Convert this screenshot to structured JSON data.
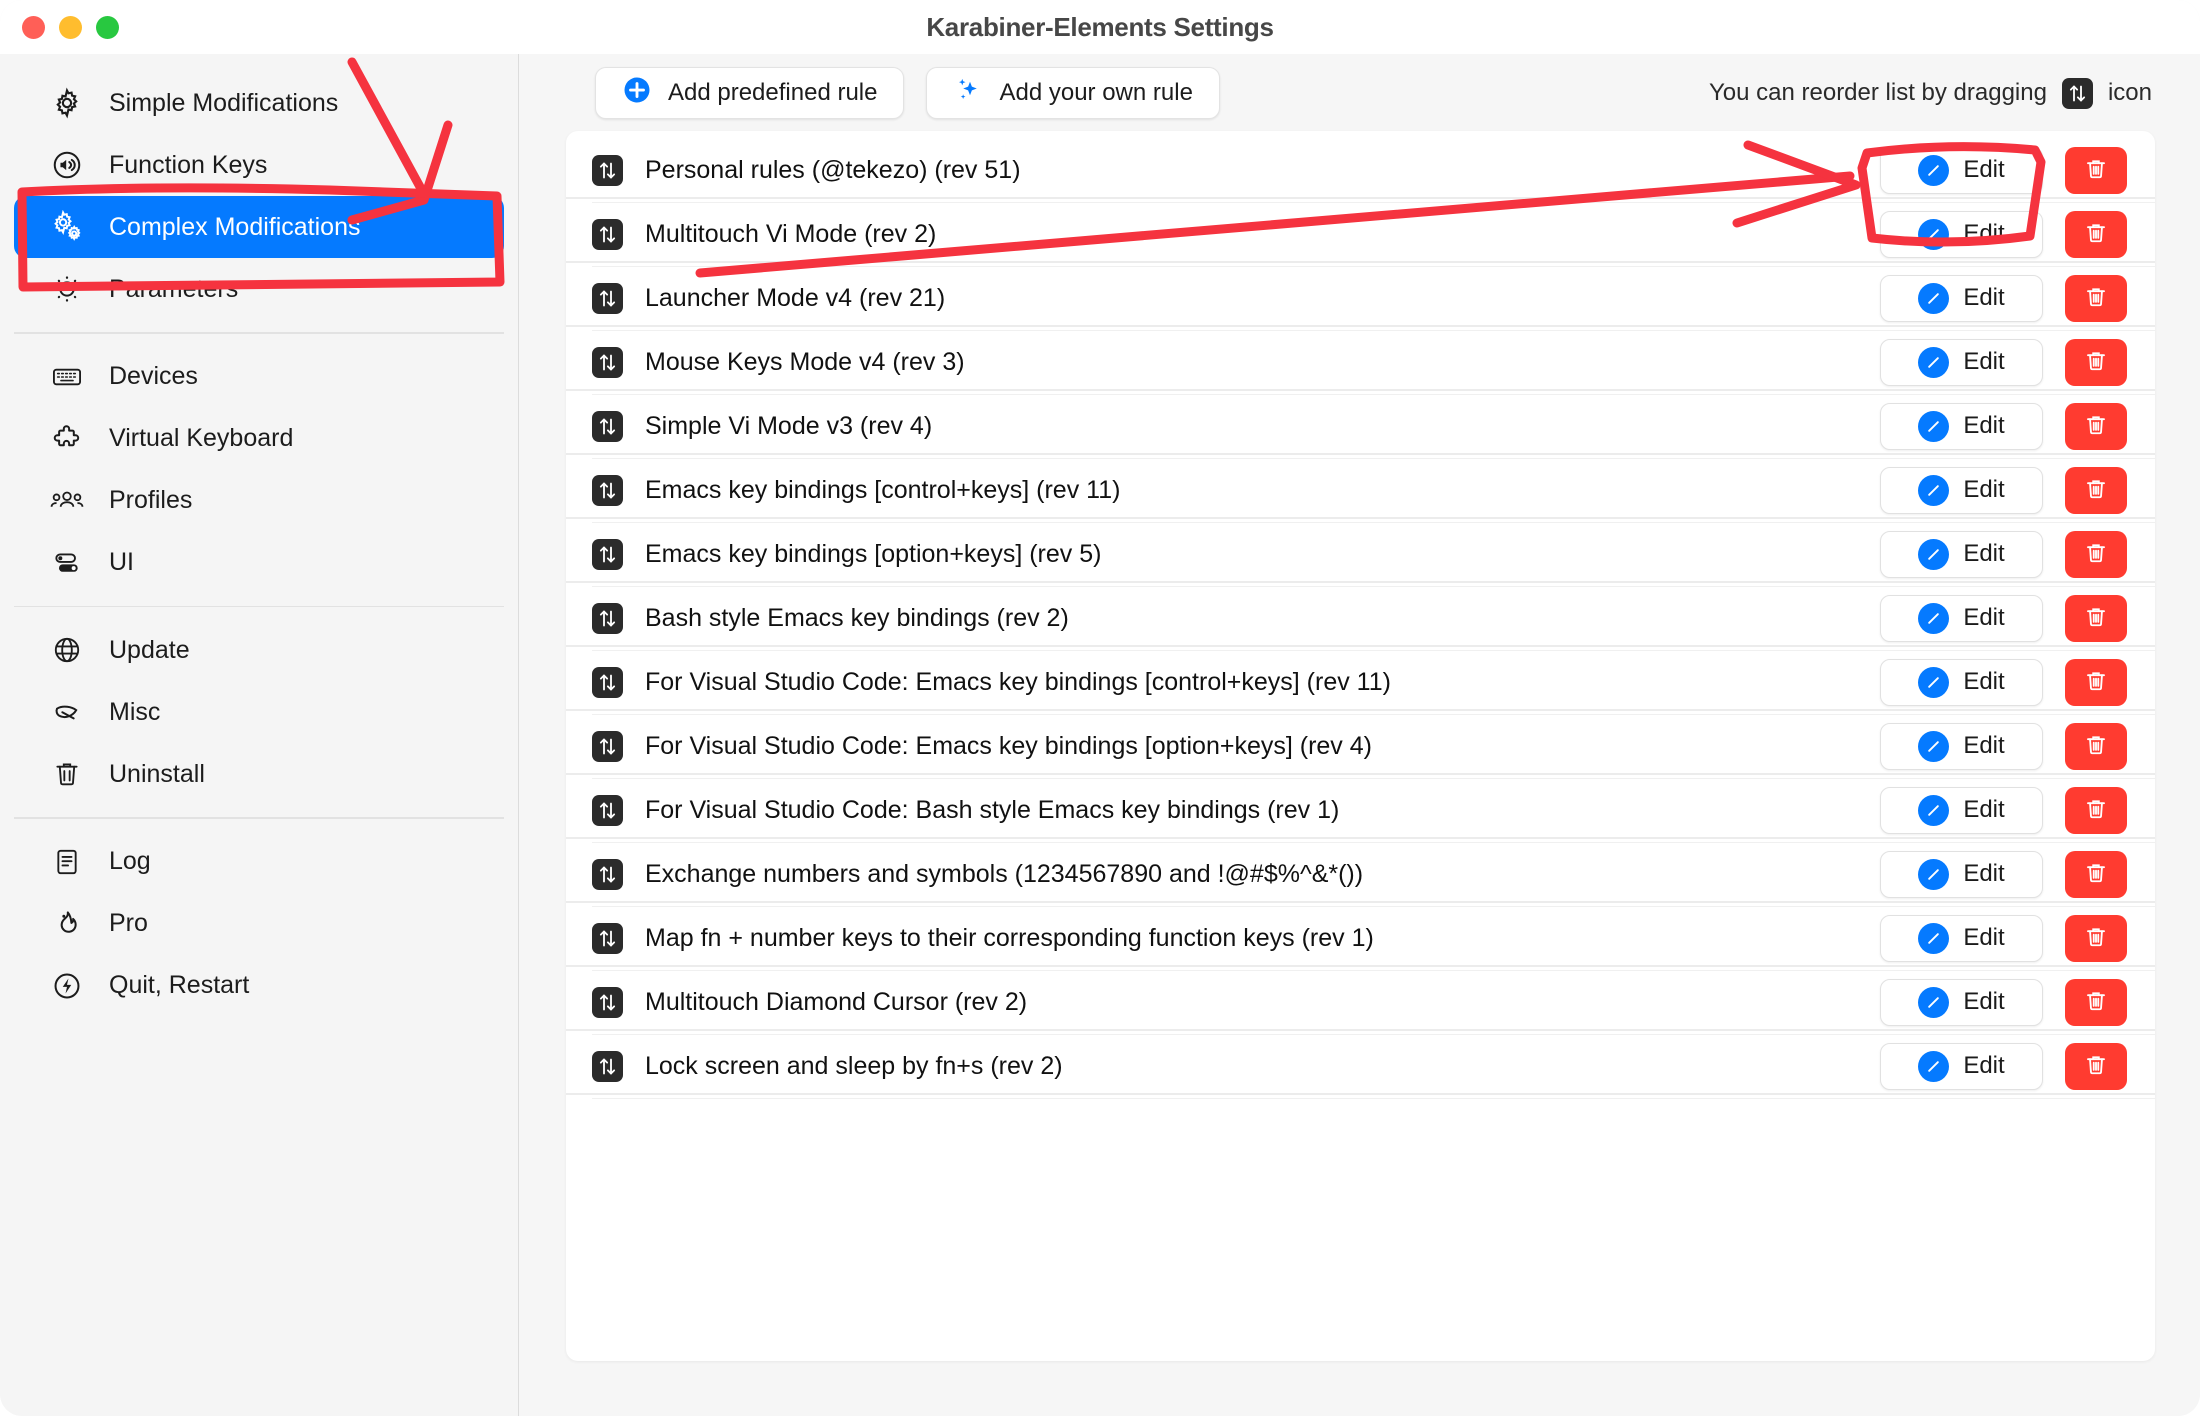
{
  "window": {
    "title": "Karabiner-Elements Settings",
    "traffic_lights": [
      "close-button",
      "minimize-button",
      "zoom-button"
    ],
    "colors": {
      "accent": "#057aff",
      "danger": "#ff3b30",
      "sidebar_bg": "#f5f5f5",
      "panel_bg": "#ffffff",
      "annotation": "#f5333f",
      "close": "#ff5f57",
      "minimize": "#ffbd2e",
      "zoom": "#28c840"
    }
  },
  "sidebar": {
    "groups": [
      {
        "items": [
          {
            "label": "Simple Modifications",
            "icon": "gear-icon",
            "selected": false
          },
          {
            "label": "Function Keys",
            "icon": "speaker-icon",
            "selected": false
          },
          {
            "label": "Complex Modifications",
            "icon": "double-gear-icon",
            "selected": true
          },
          {
            "label": "Parameters",
            "icon": "dial-icon",
            "selected": false
          }
        ]
      },
      {
        "items": [
          {
            "label": "Devices",
            "icon": "keyboard-icon",
            "selected": false
          },
          {
            "label": "Virtual Keyboard",
            "icon": "puzzle-icon",
            "selected": false
          },
          {
            "label": "Profiles",
            "icon": "people-icon",
            "selected": false
          },
          {
            "label": "UI",
            "icon": "toggles-icon",
            "selected": false
          }
        ]
      },
      {
        "items": [
          {
            "label": "Update",
            "icon": "globe-icon",
            "selected": false
          },
          {
            "label": "Misc",
            "icon": "leaf-icon",
            "selected": false
          },
          {
            "label": "Uninstall",
            "icon": "trash-icon",
            "selected": false
          }
        ]
      },
      {
        "items": [
          {
            "label": "Log",
            "icon": "document-icon",
            "selected": false
          },
          {
            "label": "Pro",
            "icon": "flame-icon",
            "selected": false
          },
          {
            "label": "Quit, Restart",
            "icon": "bolt-icon",
            "selected": false
          }
        ]
      }
    ]
  },
  "toolbar": {
    "add_predefined_label": "Add predefined rule",
    "add_predefined_icon": "plus-circle-icon",
    "add_own_label": "Add your own rule",
    "add_own_icon": "sparkles-icon",
    "hint_before": "You can reorder list by dragging",
    "hint_icon": "updown-arrows-icon",
    "hint_after": "icon"
  },
  "rules": {
    "edit_label": "Edit",
    "edit_icon": "pencil-circle-icon",
    "delete_icon": "trash-icon",
    "drag_icon": "updown-arrows-icon",
    "items": [
      {
        "title": "Personal rules (@tekezo) (rev 51)"
      },
      {
        "title": "Multitouch Vi Mode (rev 2)"
      },
      {
        "title": "Launcher Mode v4 (rev 21)"
      },
      {
        "title": "Mouse Keys Mode v4 (rev 3)"
      },
      {
        "title": "Simple Vi Mode v3 (rev 4)"
      },
      {
        "title": "Emacs key bindings [control+keys] (rev 11)"
      },
      {
        "title": "Emacs key bindings [option+keys] (rev 5)"
      },
      {
        "title": "Bash style Emacs key bindings (rev 2)"
      },
      {
        "title": "For Visual Studio Code: Emacs key bindings [control+keys] (rev 11)"
      },
      {
        "title": "For Visual Studio Code: Emacs key bindings [option+keys] (rev 4)"
      },
      {
        "title": "For Visual Studio Code: Bash style Emacs key bindings (rev 1)"
      },
      {
        "title": "Exchange numbers and symbols (1234567890 and !@#$%^&*())"
      },
      {
        "title": "Map fn + number keys to their corresponding function keys (rev 1)"
      },
      {
        "title": "Multitouch Diamond Cursor (rev 2)"
      },
      {
        "title": "Lock screen and sleep by fn+s (rev 2)"
      }
    ]
  },
  "annotations": [
    {
      "name": "arrow-to-complex-modifications",
      "shape": "arrow"
    },
    {
      "name": "box-around-complex-modifications",
      "shape": "rectangle"
    },
    {
      "name": "arrow-to-edit-button",
      "shape": "long-arrow"
    },
    {
      "name": "box-around-edit-button",
      "shape": "rectangle"
    }
  ]
}
